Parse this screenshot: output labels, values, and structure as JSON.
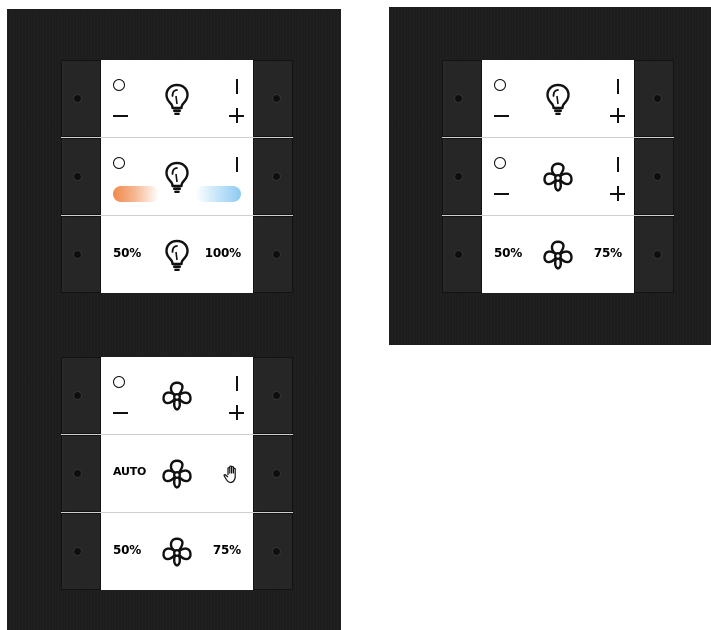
{
  "left_panel": {
    "lighting_module": [
      {
        "type": "on-off-dim",
        "off_symbol": "circle",
        "on_symbol": "bar",
        "dim_down": "minus",
        "dim_up": "plus",
        "icon": "bulb-icon"
      },
      {
        "type": "colour-temperature",
        "off_symbol": "circle",
        "on_symbol": "bar",
        "icon": "bulb-icon",
        "warm_color": "#f08a4b",
        "cool_color": "#8ccbf2"
      },
      {
        "type": "scene",
        "left_label": "50%",
        "right_label": "100%",
        "icon": "bulb-icon"
      }
    ],
    "fan_module": [
      {
        "type": "on-off-speed",
        "off_symbol": "circle",
        "on_symbol": "bar",
        "dim_down": "minus",
        "dim_up": "plus",
        "icon": "fan-icon"
      },
      {
        "type": "mode",
        "left_label": "AUTO",
        "right_icon": "hand-icon",
        "icon": "fan-icon"
      },
      {
        "type": "speed-preset",
        "left_label": "50%",
        "right_label": "75%",
        "icon": "fan-icon"
      }
    ]
  },
  "right_panel": {
    "combo_module": [
      {
        "type": "on-off-dim",
        "off_symbol": "circle",
        "on_symbol": "bar",
        "dim_down": "minus",
        "dim_up": "plus",
        "icon": "bulb-icon"
      },
      {
        "type": "on-off-speed",
        "off_symbol": "circle",
        "on_symbol": "bar",
        "dim_down": "minus",
        "dim_up": "plus",
        "icon": "fan-icon"
      },
      {
        "type": "speed-preset",
        "left_label": "50%",
        "right_label": "75%",
        "icon": "fan-icon"
      }
    ]
  },
  "colors": {
    "panel": "#1d1d1d",
    "key_face": "#ffffff",
    "ink": "#111111"
  }
}
